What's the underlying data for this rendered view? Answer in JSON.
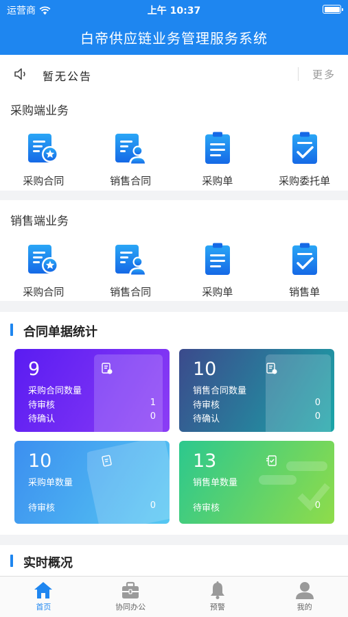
{
  "status_bar": {
    "carrier": "运营商",
    "time": "上午 10:37"
  },
  "app_title": "白帝供应链业务管理服务系统",
  "notice": {
    "text": "暂无公告",
    "more": "更多"
  },
  "purchase_section": {
    "title": "采购端业务",
    "items": [
      {
        "label": "采购合同",
        "icon": "contract-star-icon"
      },
      {
        "label": "销售合同",
        "icon": "contract-person-icon"
      },
      {
        "label": "采购单",
        "icon": "clipboard-list-icon"
      },
      {
        "label": "采购委托单",
        "icon": "clipboard-check-icon"
      }
    ]
  },
  "sales_section": {
    "title": "销售端业务",
    "items": [
      {
        "label": "采购合同",
        "icon": "contract-star-icon"
      },
      {
        "label": "销售合同",
        "icon": "contract-person-icon"
      },
      {
        "label": "采购单",
        "icon": "clipboard-list-icon"
      },
      {
        "label": "销售单",
        "icon": "clipboard-check-icon"
      }
    ]
  },
  "stats": {
    "title": "合同单据统计",
    "cards": [
      {
        "count": "9",
        "caption": "采购合同数量",
        "rows": [
          {
            "label": "待审核",
            "value": "1"
          },
          {
            "label": "待确认",
            "value": "0"
          }
        ],
        "colors": [
          "#5a1cf2",
          "#8b3df5"
        ]
      },
      {
        "count": "10",
        "caption": "销售合同数量",
        "rows": [
          {
            "label": "待审核",
            "value": "0"
          },
          {
            "label": "待确认",
            "value": "0"
          }
        ],
        "colors": [
          "#3b4a8c",
          "#1aa6a8"
        ]
      },
      {
        "count": "10",
        "caption": "采购单数量",
        "rows": [
          {
            "label": "待审核",
            "value": "0"
          }
        ],
        "colors": [
          "#3c8ff0",
          "#56c8f2"
        ]
      },
      {
        "count": "13",
        "caption": "销售单数量",
        "rows": [
          {
            "label": "待审核",
            "value": "0"
          }
        ],
        "colors": [
          "#2cc88e",
          "#8fdc4a"
        ]
      }
    ]
  },
  "realtime": {
    "title": "实时概况"
  },
  "tabbar": [
    {
      "label": "首页",
      "icon": "home-icon",
      "active": true
    },
    {
      "label": "协同办公",
      "icon": "briefcase-icon",
      "active": false
    },
    {
      "label": "预警",
      "icon": "bell-icon",
      "active": false
    },
    {
      "label": "我的",
      "icon": "user-icon",
      "active": false
    }
  ],
  "colors": {
    "brand": "#1e86f0",
    "icon_gradient": [
      "#2aa0f5",
      "#1570e8"
    ]
  }
}
